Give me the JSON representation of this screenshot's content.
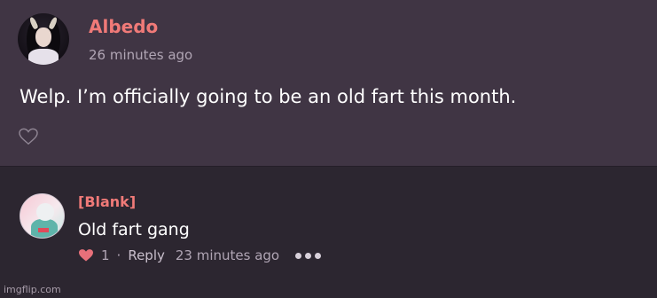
{
  "post": {
    "author": "Albedo",
    "time": "26 minutes ago",
    "text": "Welp. I’m officially going to be an old fart this month.",
    "like_icon": "heart-outline-icon"
  },
  "comment": {
    "author": "[Blank]",
    "text": "Old fart gang",
    "like_count": "1",
    "separator": "·",
    "reply_label": "Reply",
    "time": "23 minutes ago",
    "like_icon": "heart-filled-icon",
    "more_icon": "more-dots-icon"
  },
  "watermark": "imgflip.com",
  "colors": {
    "name": "#f07a78",
    "post_bg": "#403544",
    "comment_bg": "#2c2630",
    "heart": "#e8707a"
  }
}
